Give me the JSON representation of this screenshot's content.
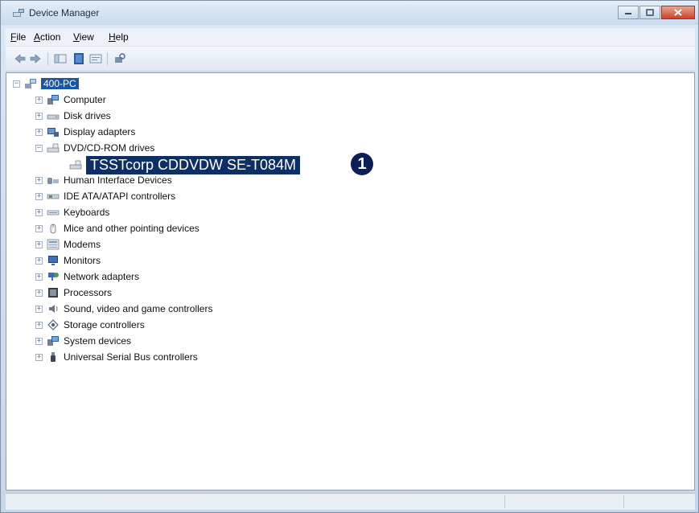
{
  "window": {
    "title": "Device Manager",
    "title_icon": "device-manager-icon"
  },
  "menu": {
    "items": [
      {
        "label": "File",
        "mnemonic": "F",
        "rest": "ile"
      },
      {
        "label": "Action",
        "mnemonic": "A",
        "rest": "ction"
      },
      {
        "label": "View",
        "mnemonic": "V",
        "rest": "iew"
      },
      {
        "label": "Help",
        "mnemonic": "H",
        "rest": "elp"
      }
    ]
  },
  "toolbar": {
    "icons": [
      "back-arrow-icon",
      "forward-arrow-icon",
      "show-hide-console-tree-icon",
      "help-icon",
      "properties-icon",
      "scan-hardware-icon"
    ]
  },
  "tree": {
    "root": {
      "label": "400-PC",
      "icon": "computer-network-icon",
      "expanded": true,
      "selected": true
    },
    "categories": [
      {
        "label": "Computer",
        "icon": "computer-icon",
        "expanded": false
      },
      {
        "label": "Disk drives",
        "icon": "disk-drive-icon",
        "expanded": false
      },
      {
        "label": "Display adapters",
        "icon": "display-adapter-icon",
        "expanded": false
      },
      {
        "label": "DVD/CD-ROM drives",
        "icon": "dvd-drive-icon",
        "expanded": true,
        "children": [
          {
            "label": "TSSTcorp CDDVDW SE-T084M",
            "icon": "dvd-drive-icon"
          }
        ]
      },
      {
        "label": "Human Interface Devices",
        "icon": "hid-icon",
        "expanded": false
      },
      {
        "label": "IDE ATA/ATAPI controllers",
        "icon": "ide-controller-icon",
        "expanded": false
      },
      {
        "label": "Keyboards",
        "icon": "keyboard-icon",
        "expanded": false
      },
      {
        "label": "Mice and other pointing devices",
        "icon": "mouse-icon",
        "expanded": false
      },
      {
        "label": "Modems",
        "icon": "modem-icon",
        "expanded": false
      },
      {
        "label": "Monitors",
        "icon": "monitor-icon",
        "expanded": false
      },
      {
        "label": "Network adapters",
        "icon": "network-adapter-icon",
        "expanded": false
      },
      {
        "label": "Processors",
        "icon": "processor-icon",
        "expanded": false
      },
      {
        "label": "Sound, video and game controllers",
        "icon": "speaker-icon",
        "expanded": false
      },
      {
        "label": "Storage controllers",
        "icon": "storage-controller-icon",
        "expanded": false
      },
      {
        "label": "System devices",
        "icon": "system-devices-icon",
        "expanded": false
      },
      {
        "label": "Universal Serial Bus controllers",
        "icon": "usb-icon",
        "expanded": false
      }
    ]
  },
  "annotation": {
    "marker": "1"
  },
  "colors": {
    "selection": "#1c55a0",
    "highlight": "#0e2f63",
    "marker": "#0c1f55"
  }
}
